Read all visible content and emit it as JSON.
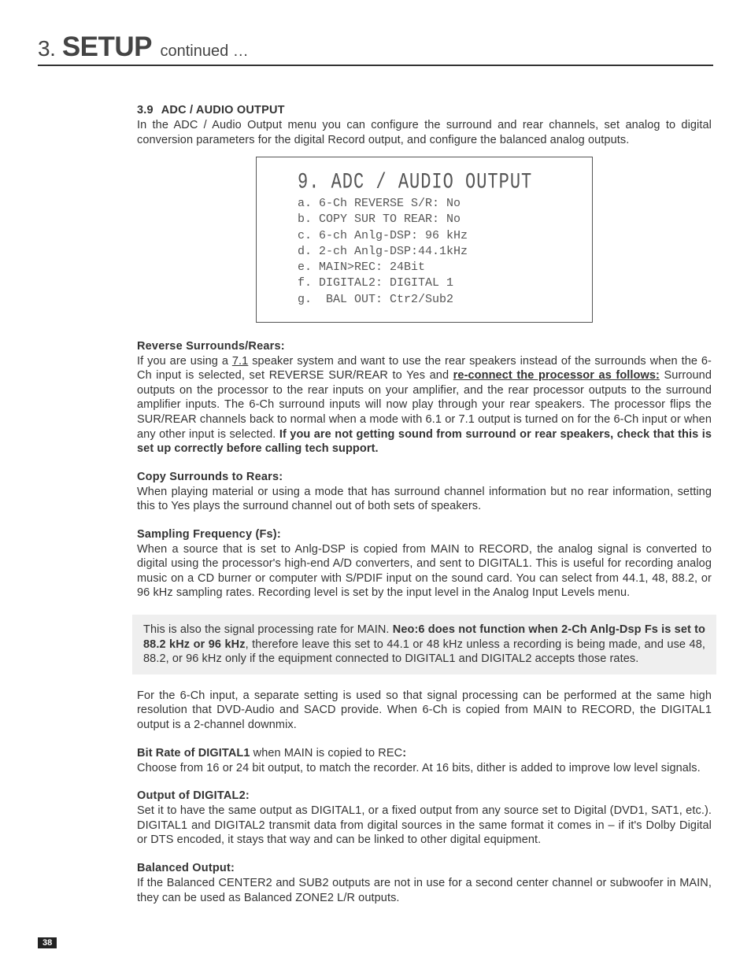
{
  "header": {
    "chapter_num": "3.",
    "chapter_title": "SETUP",
    "continued": "continued …"
  },
  "section": {
    "num": "3.9",
    "title": "ADC / AUDIO OUTPUT",
    "intro": "In the ADC / Audio Output menu you can configure the surround and rear channels, set analog to digital conversion parameters for the digital Record output, and configure the balanced analog outputs."
  },
  "osd": {
    "title": "9. ADC / AUDIO OUTPUT",
    "lines": [
      "a. 6-Ch REVERSE S/R: No",
      "b. COPY SUR TO REAR: No",
      "c. 6-ch Anlg-DSP: 96 kHz",
      "d. 2-ch Anlg-DSP:44.1kHz",
      "e. MAIN>REC: 24Bit",
      "f. DIGITAL2: DIGITAL 1",
      "g.  BAL OUT: Ctr2/Sub2"
    ]
  },
  "reverse": {
    "head": "Reverse Surrounds/Rears:",
    "t1": "If you are using a ",
    "u1": "7.1",
    "t2": " speaker system and want to use the rear speakers instead of the surrounds when the 6-Ch input is selected, set REVERSE SUR/REAR to Yes and ",
    "bu1": "re-connect the processor as follows:",
    "t3": " Surround outputs on the processor to the rear inputs on your amplifier, and the rear processor outputs to the surround amplifier inputs. The 6-Ch surround inputs will now play through your rear speakers. The processor flips the SUR/REAR channels back to normal when a mode with 6.1 or 7.1 output is turned on for the 6-Ch input or when any other input is selected. ",
    "b1": "If you are not getting sound from surround or rear speakers, check that this is set up correctly before calling tech support."
  },
  "copy": {
    "head": "Copy Surrounds to Rears:",
    "body": "When playing material or using a mode that has surround channel information but no rear information, setting this to Yes plays the surround channel out of both sets of speakers."
  },
  "fs": {
    "head": "Sampling Frequency (Fs):",
    "body": "When a source that is set to Anlg-DSP is copied from MAIN to RECORD, the analog signal is converted to digital using the processor's high-end A/D converters, and sent to DIGITAL1. This is useful for recording analog music on a CD burner or computer with S/PDIF input on the sound card. You can select from 44.1, 48, 88.2, or 96 kHz sampling rates. Recording level is set by the input level in the Analog Input Levels menu."
  },
  "note": {
    "t1": "This is also the signal processing rate for MAIN. ",
    "b1": "Neo:6 does not function when 2-Ch Anlg-Dsp Fs is set to 88.2 kHz or 96 kHz",
    "t2": ", therefore leave this set to 44.1 or 48 kHz unless a recording is being made, and use 48, 88.2, or 96 kHz only if the equipment connected to DIGITAL1 and DIGITAL2 accepts those rates."
  },
  "fs2": {
    "body": "For the 6-Ch input, a separate setting is used so that signal processing can be performed at the same high resolution that DVD-Audio and SACD provide. When 6-Ch is copied from MAIN to RECORD, the DIGITAL1 output is a 2-channel downmix."
  },
  "bitrate": {
    "head": "Bit Rate of DIGITAL1",
    "tail": " when MAIN is copied to REC",
    "colon": ":",
    "body": "Choose from 16 or 24 bit output, to match the recorder. At 16 bits, dither is added to improve low level signals."
  },
  "dig2": {
    "head": "Output of DIGITAL2:",
    "body": "Set it to have the same output as DIGITAL1, or a fixed output from any source set to Digital (DVD1, SAT1, etc.). DIGITAL1 and DIGITAL2 transmit data from digital sources in the same format it comes in – if it's Dolby Digital or DTS encoded, it stays that way and can be linked to other digital equipment."
  },
  "bal": {
    "head": "Balanced Output:",
    "body": "If the Balanced CENTER2 and SUB2 outputs are not in use for a second center channel or subwoofer in MAIN, they can be used as Balanced ZONE2 L/R outputs."
  },
  "pagenum": "38"
}
